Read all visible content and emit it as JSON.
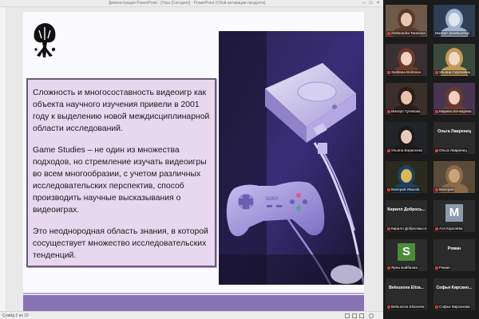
{
  "window": {
    "title": "Демонстрация PowerPoint - [Угра (Сегодня)] - PowerPoint (Сбой активации продукта)",
    "controls": {
      "minimize": "–",
      "maximize": "□",
      "close": "×"
    }
  },
  "slide": {
    "paragraphs": [
      "Сложность и многосоставность видеоигр как объекта научного изучения привели в 2001 году к выделению новой междисциплинарной области исследований.",
      "Game Studies – не один из множества подходов, но стремление изучать видеоигры во всем многообразии, с учетом различных исследовательских перспектив, способ производить научные высказывания о видеоиграх.",
      "Это неоднородная область знания, в которой сосуществует множество исследовательских тенденций."
    ],
    "photo_subject": "game-console-photo",
    "colors": {
      "text_box_bg": "#e7d7ef",
      "text_box_border": "#6a5880",
      "bottom_band": "#8772b3"
    }
  },
  "statusbar": {
    "slide_counter": "Слайд 2 из 10"
  },
  "gallery": {
    "participants": [
      {
        "name": "Aleksandra Tarasova",
        "type": "video",
        "muted": true
      },
      {
        "name": "Импорт (компьютер)",
        "type": "video",
        "muted": false
      },
      {
        "name": "Svetlana Borisova",
        "type": "video",
        "muted": true
      },
      {
        "name": "Ульяна Сергеевна",
        "type": "video",
        "muted": true,
        "active": true
      },
      {
        "name": "Импорт Гулякова",
        "type": "video",
        "muted": true
      },
      {
        "name": "Марина Бочкарева",
        "type": "video",
        "muted": true
      },
      {
        "name": "Ульяна Борисенко",
        "type": "video",
        "muted": true
      },
      {
        "name": "Ольга Лавренец",
        "display": "Ольга Лавренец",
        "type": "name",
        "muted": true
      },
      {
        "name": "Валерий Иванов",
        "type": "video",
        "muted": true
      },
      {
        "name": "Валерия",
        "type": "video",
        "muted": true
      },
      {
        "name": "Кирилл Добросмыслов",
        "display": "Кирилл Добрось...",
        "type": "name",
        "muted": true
      },
      {
        "name": "Ася Королёва",
        "initial": "M",
        "type": "avatar",
        "avatar_color": "#8a9bab",
        "muted": true
      },
      {
        "name": "Ярна Байбахиа",
        "initial": "S",
        "type": "avatar",
        "avatar_color": "#4c8c3a",
        "muted": true
      },
      {
        "name": "Роман",
        "display": "Роман",
        "type": "name",
        "muted": true
      },
      {
        "name": "Belousova Elizaveta",
        "display": "Belousova Eliza...",
        "type": "name",
        "muted": true
      },
      {
        "name": "Софья Кирсанова",
        "display": "Софья Кирсано...",
        "type": "name",
        "muted": true
      }
    ]
  }
}
